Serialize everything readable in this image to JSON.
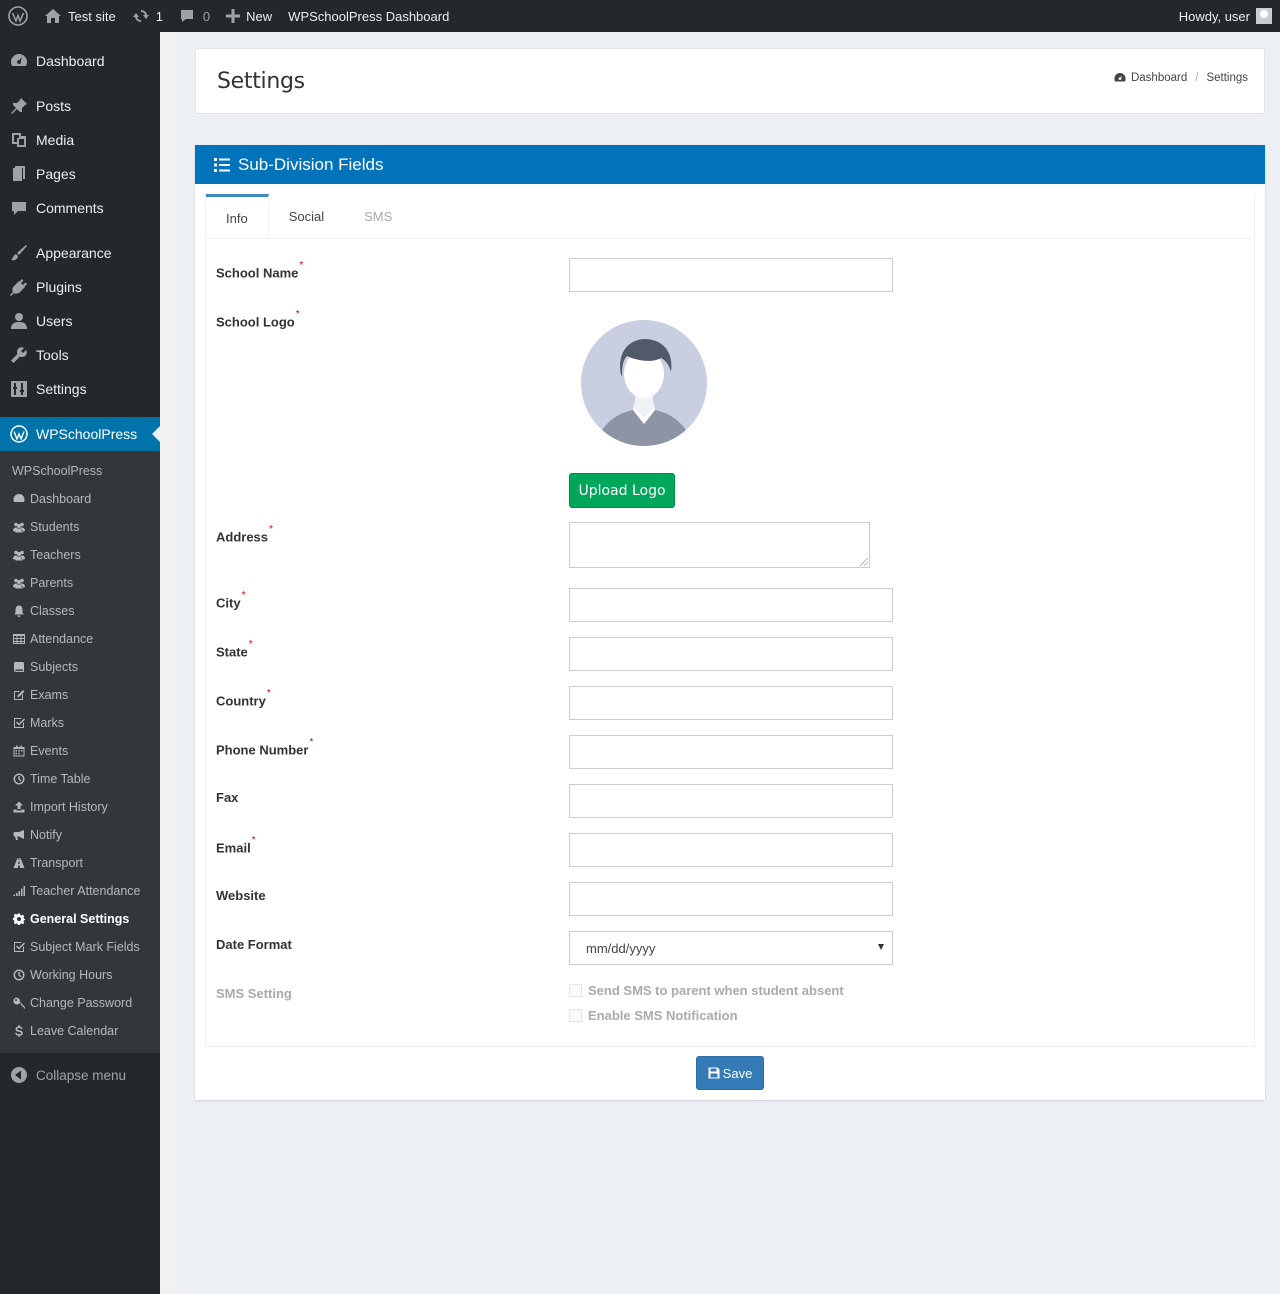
{
  "adminbar": {
    "site_name": "Test site",
    "updates_count": "1",
    "comments_count": "0",
    "new_label": "New",
    "dashboard_label": "WPSchoolPress Dashboard",
    "howdy": "Howdy, user"
  },
  "sidebar": {
    "items": [
      {
        "label": "Dashboard",
        "icon": "dashboard-icon"
      },
      {
        "label": "Posts",
        "icon": "pin-icon"
      },
      {
        "label": "Media",
        "icon": "media-icon"
      },
      {
        "label": "Pages",
        "icon": "pages-icon"
      },
      {
        "label": "Comments",
        "icon": "comment-icon"
      },
      {
        "label": "Appearance",
        "icon": "brush-icon"
      },
      {
        "label": "Plugins",
        "icon": "plugin-icon"
      },
      {
        "label": "Users",
        "icon": "user-icon"
      },
      {
        "label": "Tools",
        "icon": "wrench-icon"
      },
      {
        "label": "Settings",
        "icon": "settings-icon"
      }
    ],
    "active": {
      "label": "WPSchoolPress",
      "icon": "wordpress-icon"
    },
    "submenu": [
      {
        "label": "WPSchoolPress"
      },
      {
        "label": "Dashboard",
        "icon": "dashboard-icon"
      },
      {
        "label": "Students",
        "icon": "users-icon"
      },
      {
        "label": "Teachers",
        "icon": "users-icon"
      },
      {
        "label": "Parents",
        "icon": "users-icon"
      },
      {
        "label": "Classes",
        "icon": "bell-icon"
      },
      {
        "label": "Attendance",
        "icon": "table-icon"
      },
      {
        "label": "Subjects",
        "icon": "book-icon"
      },
      {
        "label": "Exams",
        "icon": "edit-icon"
      },
      {
        "label": "Marks",
        "icon": "check-square-icon"
      },
      {
        "label": "Events",
        "icon": "calendar-icon"
      },
      {
        "label": "Time Table",
        "icon": "clock-icon"
      },
      {
        "label": "Import History",
        "icon": "upload-icon"
      },
      {
        "label": "Notify",
        "icon": "bullhorn-icon"
      },
      {
        "label": "Transport",
        "icon": "road-icon"
      },
      {
        "label": "Teacher Attendance",
        "icon": "signal-icon"
      },
      {
        "label": "General Settings",
        "icon": "gear-icon"
      },
      {
        "label": "Subject Mark Fields",
        "icon": "check-square-icon"
      },
      {
        "label": "Working Hours",
        "icon": "clock-icon"
      },
      {
        "label": "Change Password",
        "icon": "key-icon"
      },
      {
        "label": "Leave Calendar",
        "icon": "dollar-icon"
      }
    ],
    "collapse_label": "Collapse menu"
  },
  "header": {
    "title": "Settings",
    "breadcrumb": [
      "Dashboard",
      "Settings"
    ]
  },
  "panel": {
    "title": "Sub-Division Fields",
    "tabs": [
      "Info",
      "Social",
      "SMS"
    ]
  },
  "form": {
    "school_name": "School Name",
    "school_logo": "School Logo",
    "upload_logo": "Upload Logo",
    "address": "Address",
    "city": "City",
    "state": "State",
    "country": "Country",
    "phone": "Phone Number",
    "fax": "Fax",
    "email": "Email",
    "website": "Website",
    "date_format": "Date Format",
    "date_format_value": "mm/dd/yyyy",
    "sms_setting": "SMS Setting",
    "sms_absent": "Send SMS to parent when student absent",
    "sms_enable": "Enable SMS Notification",
    "required_mark": "*",
    "save_label": "Save"
  },
  "colors": {
    "accent": "#0073bb",
    "sidebar": "#23282d",
    "success": "#00a65a",
    "primary": "#337ab7"
  }
}
